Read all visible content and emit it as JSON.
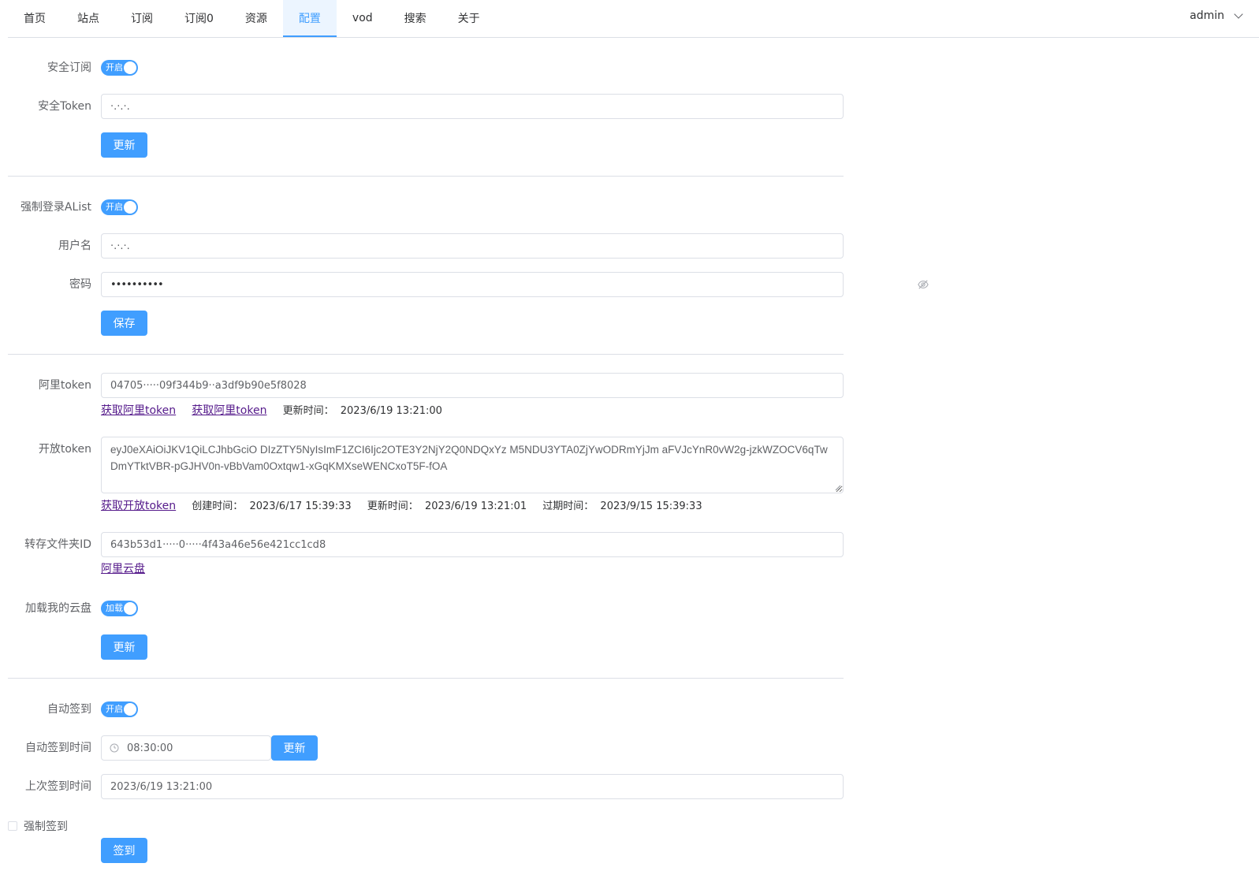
{
  "nav": {
    "items": [
      {
        "label": "首页",
        "active": false
      },
      {
        "label": "站点",
        "active": false
      },
      {
        "label": "订阅",
        "active": false
      },
      {
        "label": "订阅0",
        "active": false
      },
      {
        "label": "资源",
        "active": false
      },
      {
        "label": "配置",
        "active": true
      },
      {
        "label": "vod",
        "active": false
      },
      {
        "label": "搜索",
        "active": false
      },
      {
        "label": "关于",
        "active": false
      }
    ],
    "user": "admin"
  },
  "colors": {
    "accent": "#409eff",
    "border": "#dcdfe6",
    "link": "#551a8b"
  },
  "secure": {
    "label": "安全订阅",
    "switch_text": "开启",
    "token_label": "安全Token",
    "token_value": "·.·.·.",
    "update_button": "更新"
  },
  "alist": {
    "label": "强制登录AList",
    "switch_text": "开启",
    "username_label": "用户名",
    "username_value": "·.·.·.",
    "password_label": "密码",
    "password_value": "••••••••••",
    "save_button": "保存"
  },
  "aliyun": {
    "token_label": "阿里token",
    "token_value": "04705·····09f344b9··a3df9b90e5f8028",
    "link1": "获取阿里token",
    "link2": "获取阿里token",
    "update_time_label": "更新时间：",
    "update_time_value": "2023/6/19 13:21:00",
    "open_token_label": "开放token",
    "open_token_value": "eyJ0eXAiOiJKV1QiLCJhbGciO                                                              DIzZTY5NyIsImF1ZCI6Ijc2OTE3Y2NjY2Q0NDQxYz M5NDU3YTA0ZjYwODRmYjJm                                                                     aFVJcYnR0vW2g-jzkWZOCV6qTwDmYTktVBR-pGJHV0n-vBbVam0Oxtqw1-xGqKMXseWENCxoT5F-fOA",
    "open_link": "获取开放token",
    "created_label": "创建时间：",
    "created_value": "2023/6/17 15:39:33",
    "open_update_label": "更新时间：",
    "open_update_value": "2023/6/19 13:21:01",
    "expire_label": "过期时间：",
    "expire_value": "2023/9/15 15:39:33",
    "folder_label": "转存文件夹ID",
    "folder_value": "643b53d1·····0·····4f43a46e56e421cc1cd8",
    "drive_link": "阿里云盘",
    "mount_label": "加载我的云盘",
    "mount_switch_text": "加载",
    "update_button": "更新"
  },
  "checkin": {
    "label": "自动签到",
    "switch_text": "开启",
    "time_label": "自动签到时间",
    "time_value": "08:30:00",
    "time_button": "更新",
    "last_label": "上次签到时间",
    "last_value": "2023/6/19 13:21:00",
    "force_label": "强制签到",
    "checkin_button": "签到"
  }
}
